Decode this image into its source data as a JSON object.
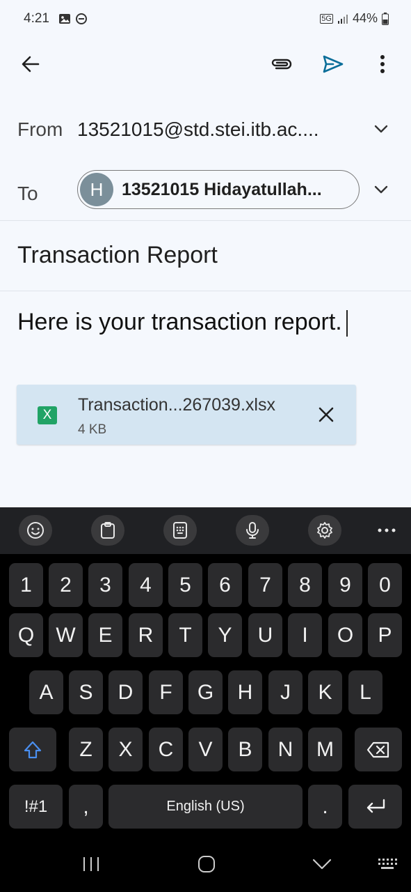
{
  "status_bar": {
    "time": "4:21",
    "network": "5G",
    "battery": "44%"
  },
  "app_bar": {
    "back_icon": "arrow-left-icon",
    "attach_icon": "paperclip-icon",
    "send_icon": "send-icon",
    "more_icon": "more-vertical-icon",
    "send_color": "#0b6e99"
  },
  "compose": {
    "from_label": "From",
    "from_value": "13521015@std.stei.itb.ac....",
    "to_label": "To",
    "to_chip": {
      "avatar_letter": "H",
      "text": "13521015 Hidayatullah..."
    },
    "subject": "Transaction Report",
    "body": "Here is your transaction report."
  },
  "attachment": {
    "icon_letter": "X",
    "file_name": "Transaction...267039.xlsx",
    "file_size": "4 KB"
  },
  "keyboard": {
    "toolbar": [
      "emoji-icon",
      "clipboard-icon",
      "keypad-icon",
      "microphone-icon",
      "settings-icon",
      "more-horizontal-icon"
    ],
    "number_row": [
      "1",
      "2",
      "3",
      "4",
      "5",
      "6",
      "7",
      "8",
      "9",
      "0"
    ],
    "row1": [
      "Q",
      "W",
      "E",
      "R",
      "T",
      "Y",
      "U",
      "I",
      "O",
      "P"
    ],
    "row2": [
      "A",
      "S",
      "D",
      "F",
      "G",
      "H",
      "J",
      "K",
      "L"
    ],
    "row3": [
      "Z",
      "X",
      "C",
      "V",
      "B",
      "N",
      "M"
    ],
    "symbols_key": "!#1",
    "comma_key": ",",
    "space_key": "English (US)",
    "period_key": "."
  },
  "nav_bar": [
    "recents-icon",
    "home-icon",
    "back-chevron-icon",
    "keyboard-toggle-icon"
  ]
}
